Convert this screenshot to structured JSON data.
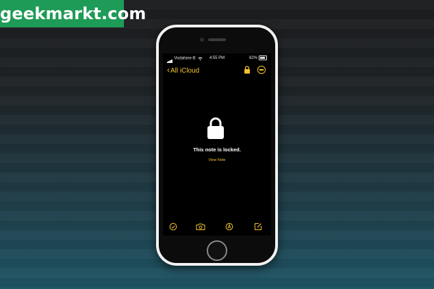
{
  "watermark": {
    "text": "geekmarkt.com"
  },
  "status_bar": {
    "carrier": "Vodafone-B",
    "time": "4:55 PM",
    "battery": "82%"
  },
  "nav": {
    "back_label": "All iCloud"
  },
  "note": {
    "locked_message": "This note is locked.",
    "view_label": "View Note"
  },
  "toolbar": {
    "items": [
      "checklist-icon",
      "camera-icon",
      "markup-icon",
      "compose-icon"
    ]
  },
  "colors": {
    "accent": "#f4c430",
    "screen": "#000000",
    "brand": "#1e9b57"
  }
}
